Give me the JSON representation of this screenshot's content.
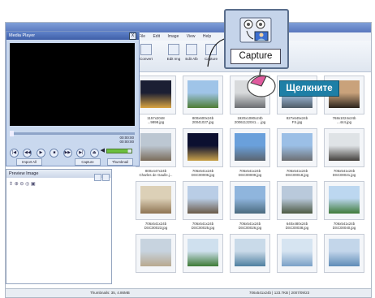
{
  "main_window": {
    "menu": [
      "File",
      "Edit",
      "Image",
      "View",
      "Help"
    ],
    "toolbar": [
      {
        "label": "Convert",
        "icon": "convert-icon"
      },
      {
        "label": "Edit Img",
        "icon": "edit-image-icon"
      },
      {
        "label": "Edit Alb",
        "icon": "edit-album-icon"
      },
      {
        "label": "Capture",
        "icon": "capture-icon"
      }
    ],
    "thumbnails": [
      {
        "caption1": "1157x2048",
        "caption2": "...9898.jpg",
        "scene": "city-night"
      },
      {
        "caption1": "800x600x24b",
        "caption2": "20041027.jpg",
        "scene": "tree"
      },
      {
        "caption1": "1920x1080x24b",
        "caption2": "20061122041... .jpg",
        "scene": "building-fog"
      },
      {
        "caption1": "827x645x24b",
        "caption2": "FS.jpg",
        "scene": "mosque-day"
      },
      {
        "caption1": "768x1024x24b",
        "caption2": "...444.jpg",
        "scene": "silhouette"
      },
      {
        "caption1": "800x447x24b",
        "caption2": "Charles de Gaulle.j...",
        "scene": "arch"
      },
      {
        "caption1": "706x541x24b",
        "caption2": "DSC00006.jpg",
        "scene": "mosque-night"
      },
      {
        "caption1": "706x541x24b",
        "caption2": "DSC00009.jpg",
        "scene": "mosque-blue"
      },
      {
        "caption1": "706x541x24b",
        "caption2": "DSC00018.jpg",
        "scene": "mosque-minaret"
      },
      {
        "caption1": "706x541x24b",
        "caption2": "DSC00021.jpg",
        "scene": "mosque-dome"
      },
      {
        "caption1": "706x541x24b",
        "caption2": "DSC00023.jpg",
        "scene": "ruins"
      },
      {
        "caption1": "706x541x24b",
        "caption2": "DSC00025.jpg",
        "scene": "tower"
      },
      {
        "caption1": "706x541x24b",
        "caption2": "DSC00026.jpg",
        "scene": "sea-coast"
      },
      {
        "caption1": "640x480x24b",
        "caption2": "DSC00038.jpg",
        "scene": "fortress"
      },
      {
        "caption1": "706x541x24b",
        "caption2": "DSC00040.jpg",
        "scene": "green-hill"
      },
      {
        "caption1": "",
        "caption2": "",
        "scene": "column"
      },
      {
        "caption1": "",
        "caption2": "",
        "scene": "garden"
      },
      {
        "caption1": "",
        "caption2": "",
        "scene": "lake"
      },
      {
        "caption1": "",
        "caption2": "",
        "scene": "boat"
      },
      {
        "caption1": "",
        "caption2": "",
        "scene": "shore"
      }
    ],
    "status_left": "Thumbnails: 35, 4.86MB",
    "status_right": "706x541x24b  | 123.7KB | 2007/09/23"
  },
  "media_player": {
    "title": "Media Player",
    "close_symbol": "X",
    "time_current": "00:00:00",
    "time_total": "00:00:00",
    "seek_fraction": 0.0,
    "controls": [
      "|◀",
      "◀◀",
      "▶",
      "■",
      "▶▶",
      "▶|",
      "⏏"
    ],
    "volume_fraction": 0.85,
    "buttons": [
      "Import All",
      "Capture",
      "Thumbnail"
    ]
  },
  "preview": {
    "title": "Preview Image",
    "tool_glyphs": [
      "⇕",
      "⊕",
      "⊖",
      "◎",
      "▣"
    ]
  },
  "capture_callout": {
    "label": "Capture"
  },
  "click_callout": {
    "label": "Щелкните"
  },
  "colors": {
    "callout_bg": "#1e7fa6",
    "player_bg": "#c9d8ee",
    "capture_bg": "#c5d4ea"
  }
}
